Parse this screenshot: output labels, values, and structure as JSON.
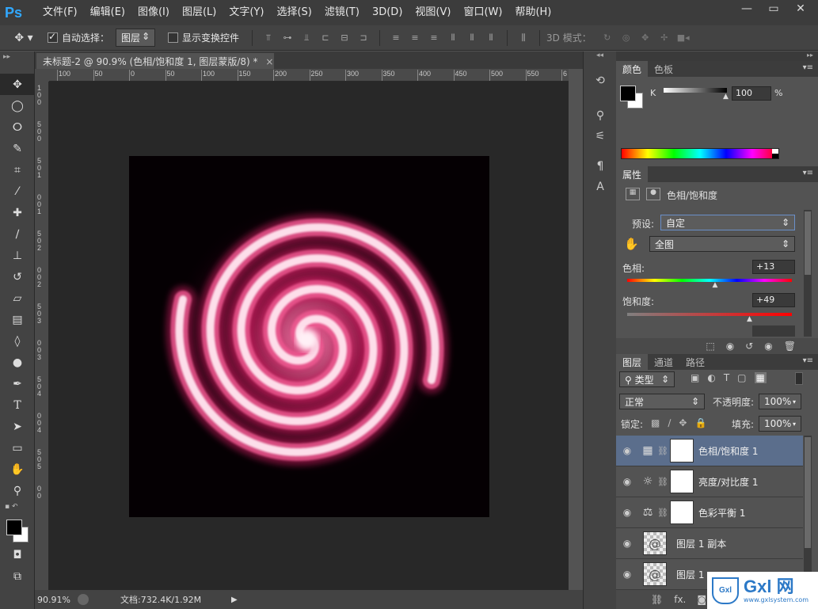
{
  "app": {
    "logo": "Ps",
    "menus": [
      "文件(F)",
      "编辑(E)",
      "图像(I)",
      "图层(L)",
      "文字(Y)",
      "选择(S)",
      "滤镜(T)",
      "3D(D)",
      "视图(V)",
      "窗口(W)",
      "帮助(H)"
    ],
    "window_controls": [
      "minimize-icon",
      "maximize-icon",
      "close-icon"
    ]
  },
  "options": {
    "auto_select_label": "自动选择：",
    "auto_select_value": "图层",
    "show_transform_label": "显示变换控件",
    "mode_3d_label": "3D 模式："
  },
  "document": {
    "tab_title": "未标题-2 @ 90.9% (色相/饱和度 1, 图层蒙版/8) *",
    "close": "×",
    "zoom": "90.91%",
    "doc_info": "文档:732.4K/1.92M",
    "ruler_h": [
      "100",
      "50",
      "0",
      "50",
      "100",
      "150",
      "200",
      "250",
      "300",
      "350",
      "400",
      "450",
      "500",
      "550",
      "6"
    ],
    "ruler_v": [
      "1",
      "0",
      "0",
      "5",
      "0",
      "0",
      "5",
      "0",
      "1",
      "0",
      "0",
      "1",
      "5",
      "0",
      "2",
      "0",
      "0",
      "2",
      "5",
      "0",
      "3",
      "0",
      "0",
      "3",
      "5",
      "0",
      "4",
      "0",
      "0",
      "4",
      "5",
      "0",
      "5",
      "0",
      "0"
    ]
  },
  "color_panel": {
    "tabs": [
      "颜色",
      "色板"
    ],
    "channel_label": "K",
    "channel_value": "100",
    "unit": "%",
    "k_level": 1.0
  },
  "properties_panel": {
    "tab": "属性",
    "title": "色相/饱和度",
    "preset_label": "预设:",
    "preset_value": "自定",
    "range_value": "全图",
    "hue_label": "色相:",
    "hue_value": "+13",
    "hue_level": 0.536,
    "sat_label": "饱和度:",
    "sat_value": "+49",
    "sat_level": 0.745
  },
  "layers_panel": {
    "tabs": [
      "图层",
      "通道",
      "路径"
    ],
    "filter_value": "类型",
    "blend_mode": "正常",
    "opacity_label": "不透明度:",
    "opacity_value": "100%",
    "lock_label": "锁定:",
    "fill_label": "填充:",
    "fill_value": "100%",
    "layers": [
      {
        "name": "色相/饱和度 1",
        "icon": "hue-sat-icon",
        "selected": true
      },
      {
        "name": "亮度/对比度 1",
        "icon": "brightness-icon",
        "selected": false
      },
      {
        "name": "色彩平衡 1",
        "icon": "balance-icon",
        "selected": false
      },
      {
        "name": "图层 1 副本",
        "icon": "",
        "selected": false
      },
      {
        "name": "图层 1",
        "icon": "",
        "selected": false
      }
    ]
  },
  "watermark": {
    "brand": "Gxl 网",
    "url": "www.gxlsystem.com"
  },
  "colors": {
    "accent": "#31a8ff",
    "selected_layer": "#5b6e8c",
    "swirl": "#e0236a"
  }
}
